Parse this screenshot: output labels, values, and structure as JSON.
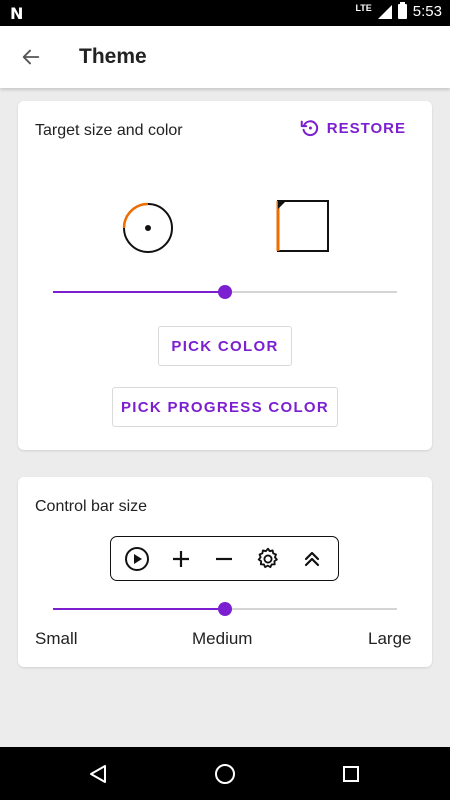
{
  "status_bar": {
    "notification_icon": "N",
    "network_type": "LTE",
    "time": "5:53"
  },
  "app_bar": {
    "title": "Theme",
    "back_icon": "arrow-back-icon"
  },
  "target_card": {
    "title": "Target size and color",
    "restore_label": "RESTORE",
    "restore_icon": "restore-icon",
    "size_slider_fraction": 0.5,
    "pick_color_label": "PICK COLOR",
    "pick_progress_color_label": "PICK PROGRESS COLOR",
    "target_color": "#111111",
    "progress_color": "#ef6c00"
  },
  "control_bar_card": {
    "title": "Control bar size",
    "icons": [
      "play-circle-icon",
      "plus-icon",
      "minus-icon",
      "gear-icon",
      "double-chevron-up-icon"
    ],
    "size_slider_fraction": 0.5,
    "labels": {
      "small": "Small",
      "medium": "Medium",
      "large": "Large"
    }
  },
  "colors": {
    "accent": "#7b1fd0",
    "background": "#ececec"
  },
  "nav_bar": {
    "icons": [
      "nav-back-icon",
      "nav-home-icon",
      "nav-recents-icon"
    ]
  }
}
